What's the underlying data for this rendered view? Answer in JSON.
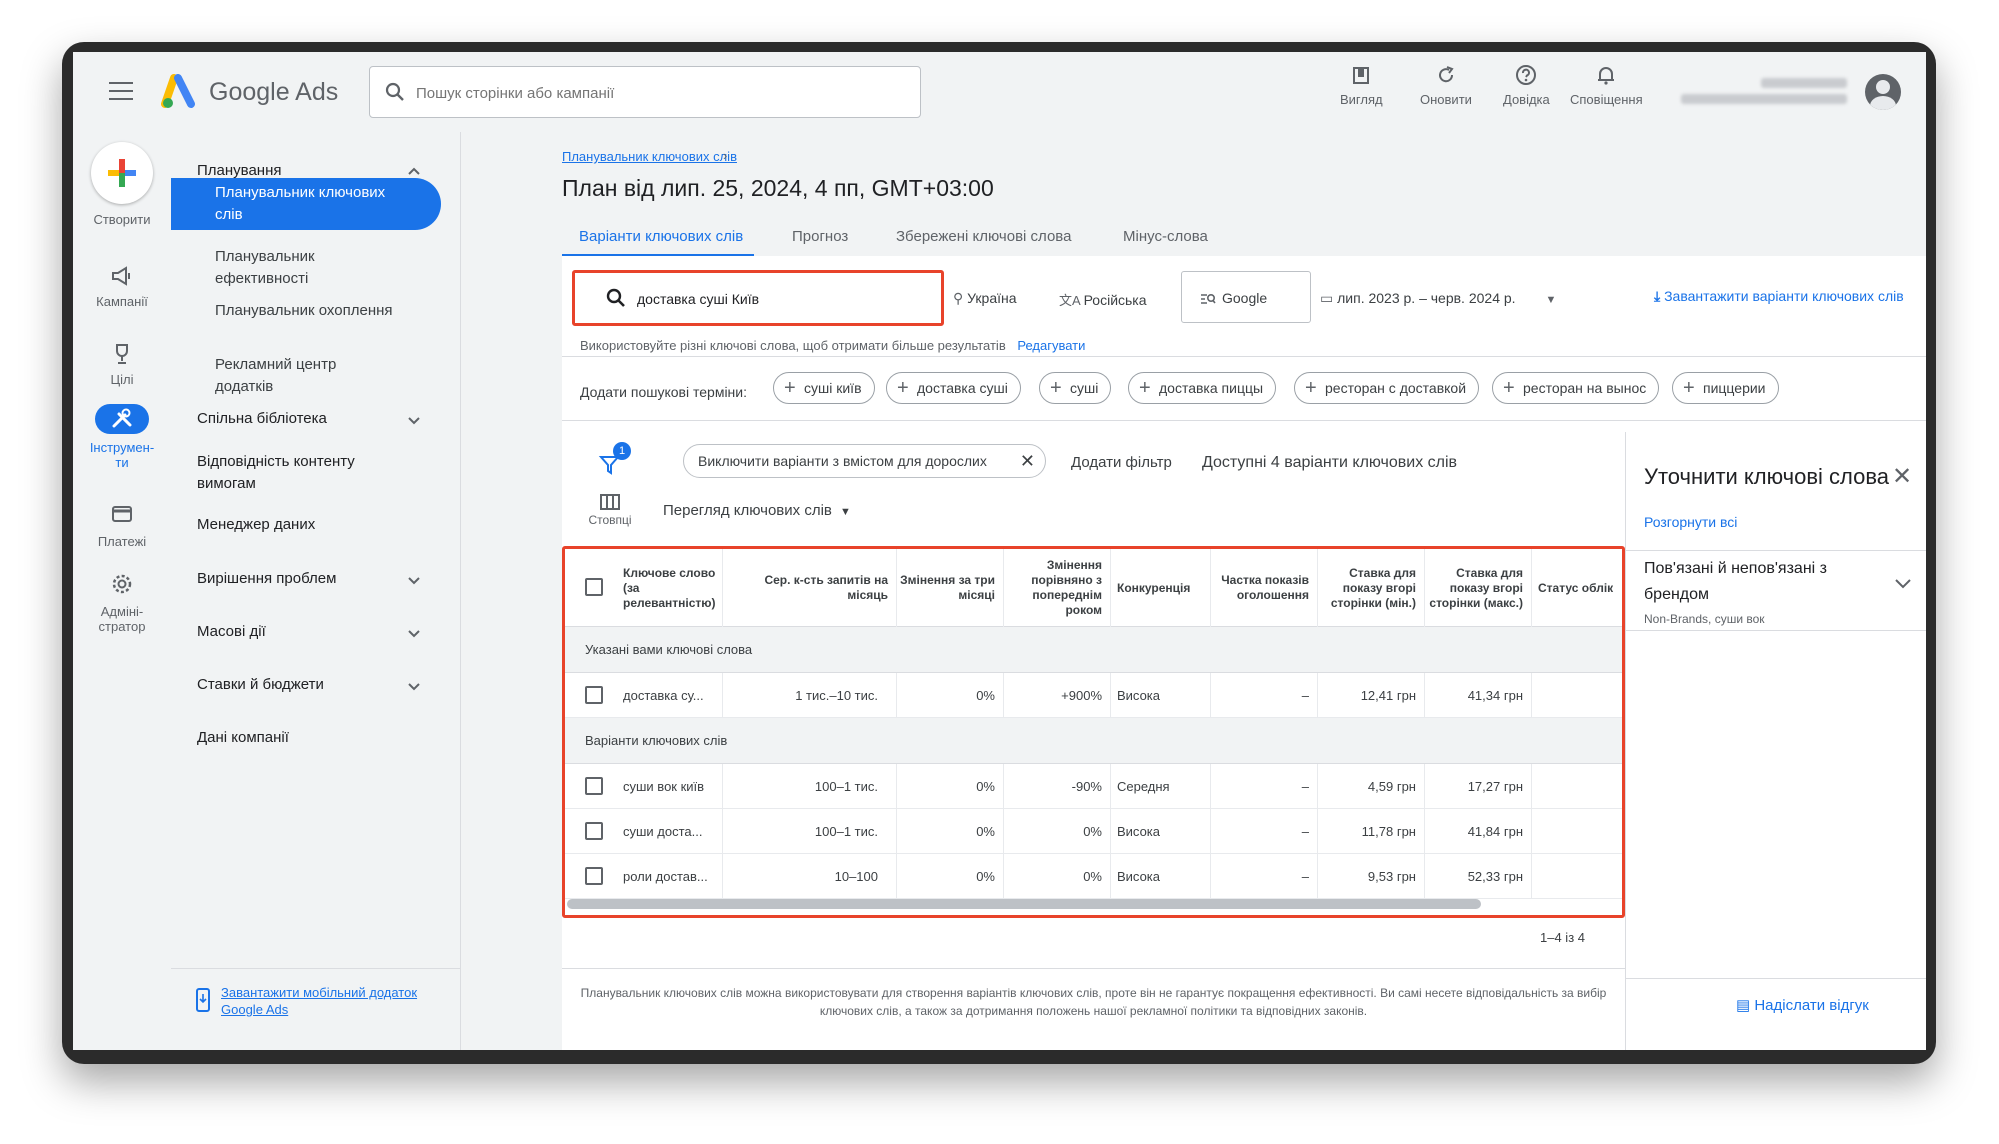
{
  "app": {
    "logo_text": "Google Ads"
  },
  "search": {
    "placeholder": "Пошук сторінки або кампанії"
  },
  "toolbar": [
    {
      "icon": "view-icon",
      "label": "Вигляд"
    },
    {
      "icon": "refresh-icon",
      "label": "Оновити"
    },
    {
      "icon": "help-icon",
      "label": "Довідка"
    },
    {
      "icon": "bell-icon",
      "label": "Сповіщення"
    }
  ],
  "rail": [
    {
      "icon": "create-plus-icon",
      "label": "Створити"
    },
    {
      "icon": "campaigns-megaphone-icon",
      "label": "Кампанії"
    },
    {
      "icon": "goals-trophy-icon",
      "label": "Цілі"
    },
    {
      "icon": "tools-wrench-icon",
      "label": "Інструмен-\nти"
    },
    {
      "icon": "billing-card-icon",
      "label": "Платежі"
    },
    {
      "icon": "admin-gear-icon",
      "label": "Адміні-\nстратор"
    }
  ],
  "nav": {
    "planning": "Планування",
    "selected": "Планувальник ключових слів",
    "sub1": "Планувальник ефективності",
    "sub2": "Планувальник охоплення",
    "sub3": "Рекламний центр додатків",
    "shared": "Спільна бібліотека",
    "suitability": "Відповідність контенту вимогам",
    "data_manager": "Менеджер даних",
    "troubleshoot": "Вирішення проблем",
    "bulk": "Масові дії",
    "bids": "Ставки й бюджети",
    "business": "Дані компанії",
    "download_app": "Завантажити мобільний додаток Google Ads"
  },
  "breadcrumb": "Планувальник ключових слів",
  "page_title": "План від лип. 25, 2024, 4 пп, GMT+03:00",
  "tabs": [
    "Варіанти ключових слів",
    "Прогноз",
    "Збережені ключові слова",
    "Мінус-слова"
  ],
  "settings": {
    "keyword": "доставка суші Київ",
    "location": "Україна",
    "language": "Російська",
    "network": "Google",
    "date_range": "лип. 2023 р. – черв. 2024 р.",
    "download": "Завантажити варіанти ключових слів",
    "hint": "Використовуйте різні ключові слова, щоб отримати більше результатів",
    "edit": "Редагувати"
  },
  "suggest": {
    "label": "Додати пошукові терміни:",
    "chips": [
      "суші київ",
      "доставка суші",
      "суші",
      "доставка пиццы",
      "ресторан с доставкой",
      "ресторан на вынос",
      "пиццерии"
    ]
  },
  "filters": {
    "badge": "1",
    "exclude_chip": "Виключити варіанти з вмістом для дорослих",
    "add_filter": "Додати фільтр",
    "available": "Доступні 4 варіанти ключових слів",
    "columns_label": "Стовпці",
    "view_label": "Перегляд ключових слів"
  },
  "table": {
    "headers": [
      "Ключове слово (за релевантністю)",
      "Сер. к-сть запитів на місяць",
      "Змінення за три місяці",
      "Змінення порівняно з попереднім роком",
      "Конкуренція",
      "Частка показів оголошення",
      "Ставка для показу вгорі сторінки (мін.)",
      "Ставка для показу вгорі сторінки (макс.)",
      "Статус облік"
    ],
    "group1": "Указані вами ключові слова",
    "rows1": [
      [
        "доставка су...",
        "1 тис.–10 тис.",
        "0%",
        "+900%",
        "Висока",
        "–",
        "12,41 грн",
        "41,34 грн"
      ]
    ],
    "group2": "Варіанти ключових слів",
    "rows2": [
      [
        "суши вок київ",
        "100–1 тис.",
        "0%",
        "-90%",
        "Середня",
        "–",
        "4,59 грн",
        "17,27 грн"
      ],
      [
        "суши доста...",
        "100–1 тис.",
        "0%",
        "0%",
        "Висока",
        "–",
        "11,78 грн",
        "41,84 грн"
      ],
      [
        "роли достав...",
        "10–100",
        "0%",
        "0%",
        "Висока",
        "–",
        "9,53 грн",
        "52,33 грн"
      ]
    ],
    "pager": "1–4 із 4"
  },
  "disclaimer": "Планувальник ключових слів можна використовувати для створення варіантів ключових слів, проте він не гарантує покращення ефективності. Ви самі несете відповідальність за вибір ключових слів, а також за дотримання положень нашої рекламної політики та відповідних законів.",
  "refine": {
    "title": "Уточнити ключові слова",
    "expand_all": "Розгорнути всі",
    "group_title": "Пов'язані й непов'язані з брендом",
    "group_sub": "Non-Brands, суши вок",
    "feedback": "Надіслати відгук"
  },
  "colors": {
    "accent": "#1a73e8",
    "highlight": "#e8432a"
  }
}
